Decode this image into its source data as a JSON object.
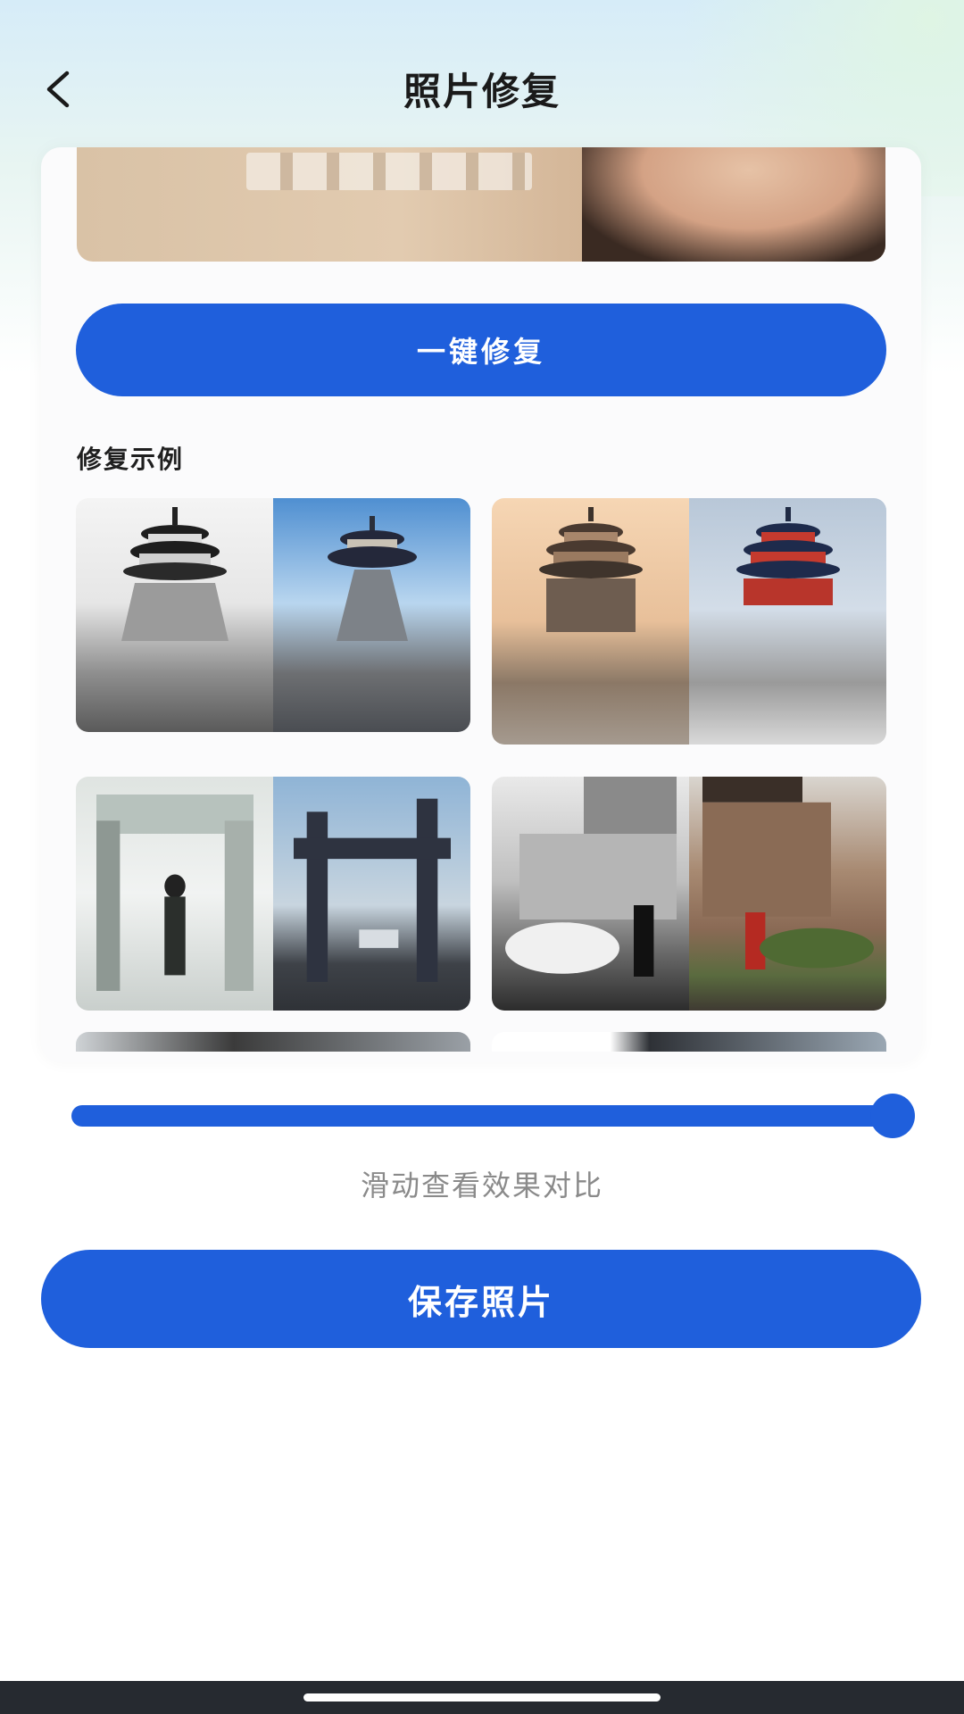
{
  "header": {
    "title": "照片修复",
    "back_icon": "chevron-left-icon"
  },
  "panel": {
    "restore_button_label": "一键修复",
    "examples_label": "修复示例",
    "examples": [
      {
        "left_tone": "bw",
        "right_tone": "color"
      },
      {
        "left_tone": "warm",
        "right_tone": "color"
      },
      {
        "left_tone": "bw",
        "right_tone": "color"
      },
      {
        "left_tone": "bw",
        "right_tone": "color"
      }
    ]
  },
  "slider": {
    "value_fraction": 1.0
  },
  "hint_text": "滑动查看效果对比",
  "save_button_label": "保存照片",
  "colors": {
    "accent": "#1f5fdc",
    "bottom_bar": "#262a30"
  }
}
